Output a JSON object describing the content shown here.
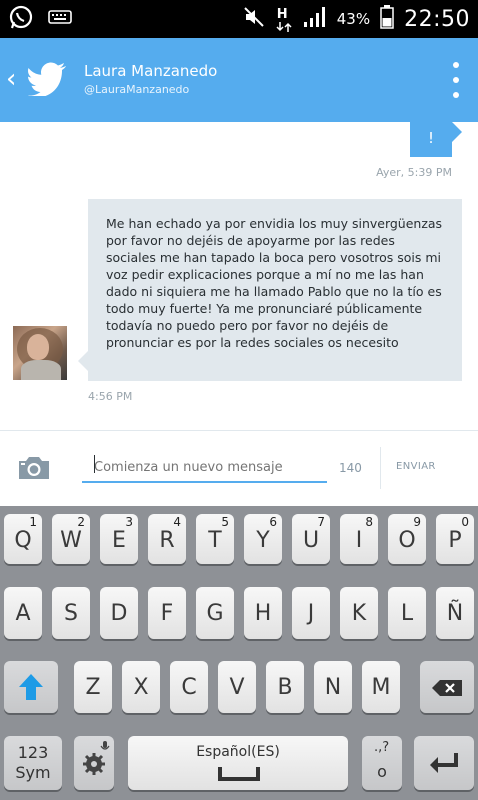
{
  "status_bar": {
    "battery_percent": "43%",
    "time": "22:50",
    "network_indicator": "H",
    "icons": [
      "whatsapp-icon",
      "keyboard-icon",
      "mute-icon",
      "signal-icon",
      "battery-icon"
    ]
  },
  "header": {
    "name": "Laura Manzanedo",
    "handle": "@LauraManzanedo",
    "icons": [
      "back-icon",
      "twitter-bird-icon",
      "overflow-menu-icon"
    ],
    "color": "#55acee"
  },
  "conversation": {
    "outgoing": {
      "text": "!",
      "timestamp": "Ayer, 5:39 PM"
    },
    "incoming": {
      "text": "Me han echado ya por envidia los muy sinvergüenzas por favor no dejéis de apoyarme por las redes sociales me han tapado la boca pero vosotros sois mi voz pedir explicaciones porque a mí no me las han dado ni siquiera me ha llamado Pablo que no la tío es todo muy fuerte! Ya me pronunciaré públicamente todavía no puedo pero por favor no dejéis de pronunciar es por la redes sociales os necesito",
      "timestamp": "4:56 PM"
    }
  },
  "compose": {
    "placeholder": "Comienza un nuevo mensaje",
    "char_count": "140",
    "send_label": "ENVIAR",
    "camera_icon": "camera-icon"
  },
  "keyboard": {
    "row1": [
      {
        "ch": "Q",
        "num": "1"
      },
      {
        "ch": "W",
        "num": "2"
      },
      {
        "ch": "E",
        "num": "3"
      },
      {
        "ch": "R",
        "num": "4"
      },
      {
        "ch": "T",
        "num": "5"
      },
      {
        "ch": "Y",
        "num": "6"
      },
      {
        "ch": "U",
        "num": "7"
      },
      {
        "ch": "I",
        "num": "8"
      },
      {
        "ch": "O",
        "num": "9"
      },
      {
        "ch": "P",
        "num": "0"
      }
    ],
    "row2": [
      "A",
      "S",
      "D",
      "F",
      "G",
      "H",
      "J",
      "K",
      "L",
      "Ñ"
    ],
    "row3": [
      "Z",
      "X",
      "C",
      "V",
      "B",
      "N",
      "M"
    ],
    "sym_label_1": "123",
    "sym_label_2": "Sym",
    "space_label": "Español(ES)",
    "punct_label": ".,?",
    "punct_label_2": "o",
    "icons": [
      "shift-icon",
      "backspace-icon",
      "settings-icon",
      "enter-icon",
      "microphone-icon"
    ]
  }
}
